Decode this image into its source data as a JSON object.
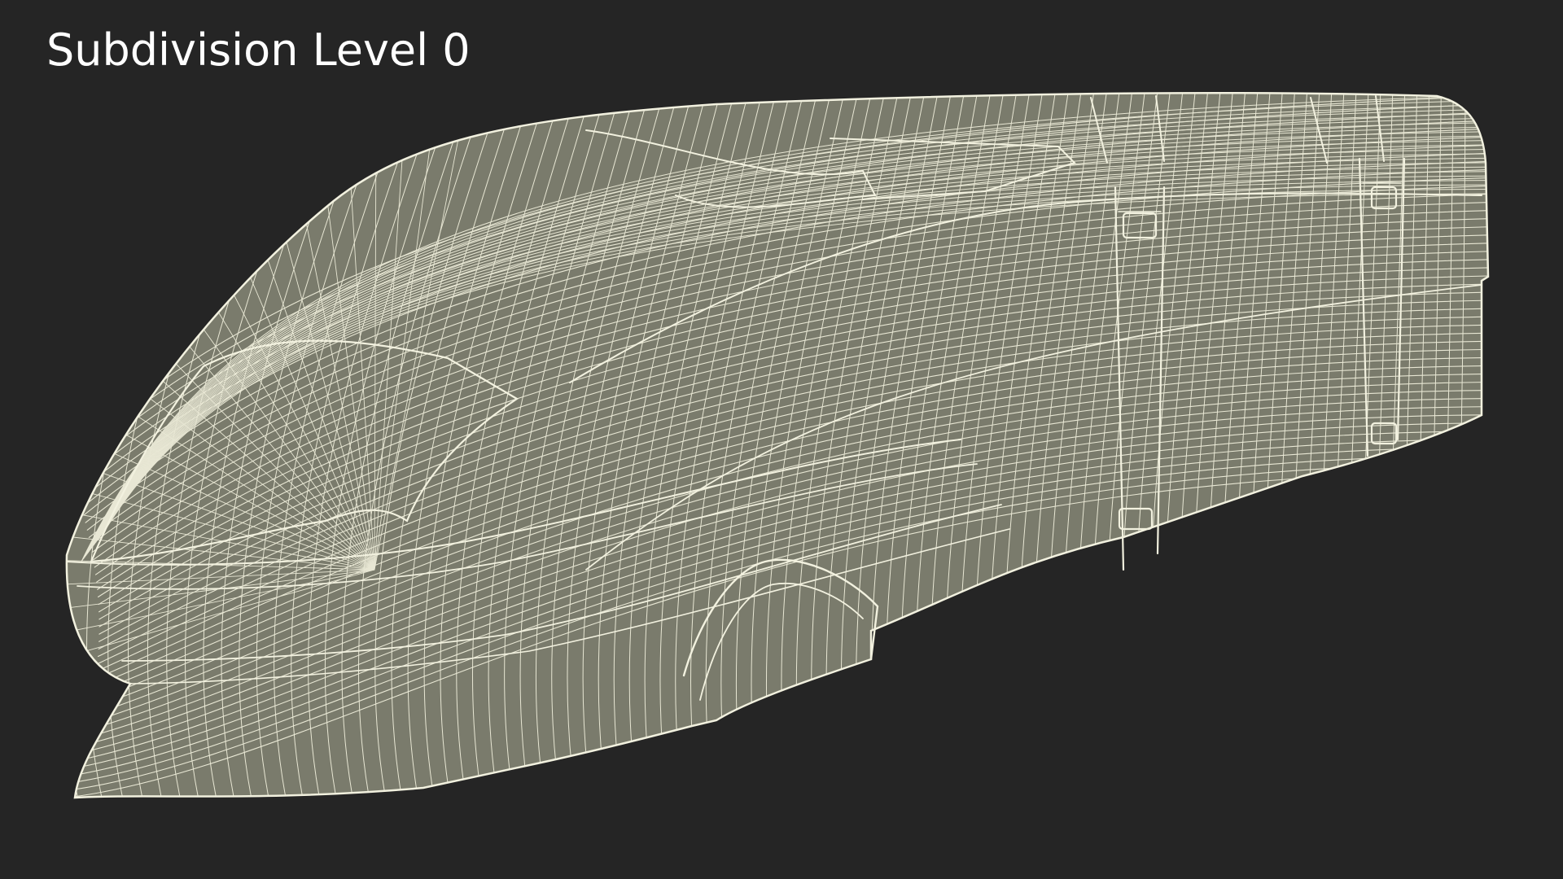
{
  "viewport": {
    "caption": "Subdivision Level 0"
  },
  "model": {
    "subject": "wireframe-train-nose",
    "surface_color": "#7a7b6c",
    "wire_color": "#e8e7d4",
    "background_color": "#252525"
  }
}
